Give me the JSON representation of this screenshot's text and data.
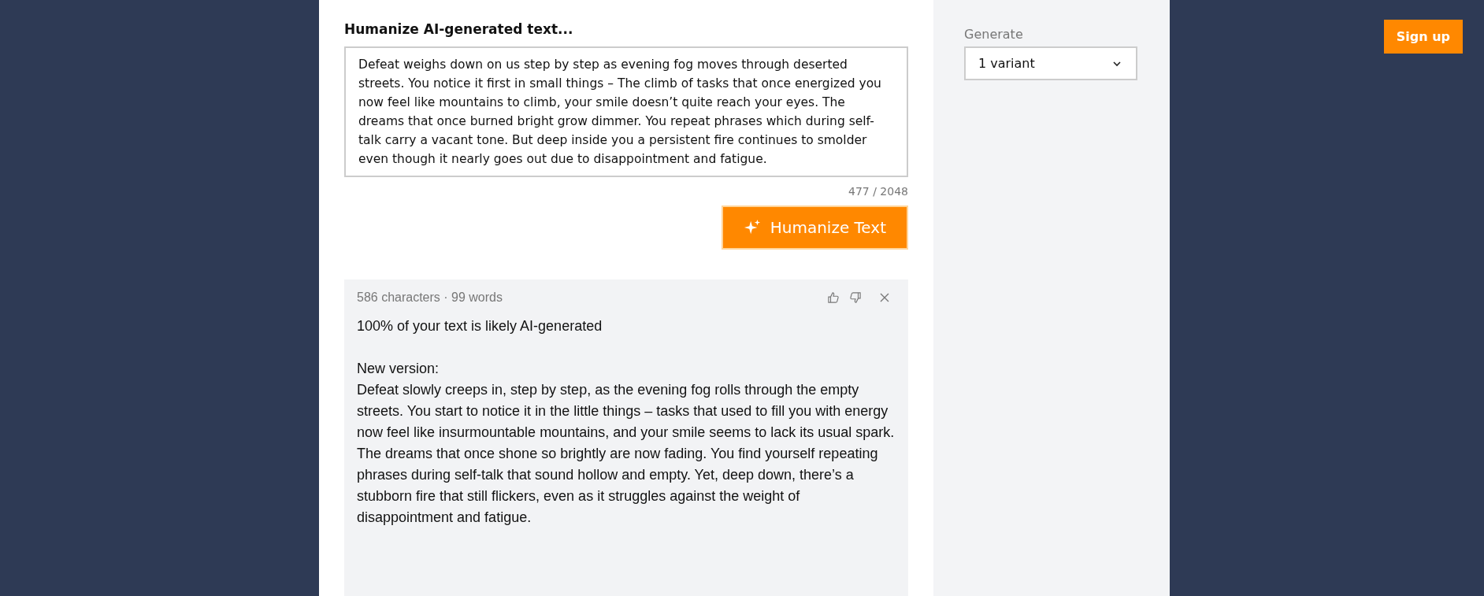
{
  "editor": {
    "title": "Humanize AI-generated text...",
    "input_text": "Defeat weighs down on us step by step as evening fog moves through deserted streets. You notice it first in small things – The climb of tasks that once energized you now feel like mountains to climb, your smile doesn’t quite reach your eyes. The dreams that once burned bright grow dimmer. You repeat phrases which during self-talk carry a vacant tone. But deep inside you a persistent fire continues to smolder even though it nearly goes out due to disappointment and fatigue.",
    "counter": "477 / 2048",
    "button": "Humanize Text"
  },
  "result": {
    "stats": "586 characters · 99 words",
    "detection": "100% of your text is likely AI-generated",
    "version_label": "New version:",
    "text": "Defeat slowly creeps in, step by step, as the evening fog rolls through the empty streets. You start to notice it in the little things – tasks that used to fill you with energy now feel like insurmountable mountains, and your smile seems to lack its usual spark. The dreams that once shone so brightly are now fading. You find yourself repeating phrases during self-talk that sound hollow and empty. Yet, deep down, there’s a stubborn fire that still flickers, even as it struggles against the weight of disappointment and fatigue."
  },
  "sidebar": {
    "label": "Generate",
    "select_value": "1 variant"
  },
  "header": {
    "signup": "Sign up"
  }
}
